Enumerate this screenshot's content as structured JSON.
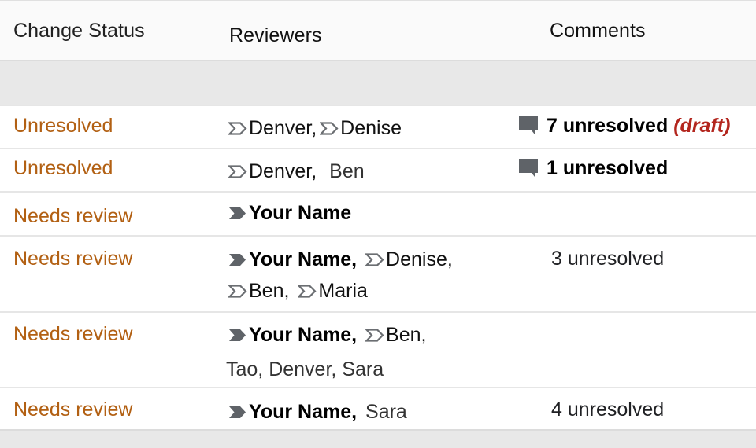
{
  "header": {
    "columns": [
      "Change Status",
      "Reviewers",
      "Comments"
    ]
  },
  "colors": {
    "status": "#b26013",
    "draft": "#b3261e",
    "icon": "#5f6368"
  },
  "rows": [
    {
      "status": "Unresolved",
      "reviewers": [
        {
          "name": "Denver,",
          "icon": "attention-outline-icon",
          "bold": false
        },
        {
          "name": "Denise",
          "icon": "attention-outline-icon",
          "bold": false
        }
      ],
      "comments": {
        "text": "7 unresolved",
        "suffix": "(draft)",
        "icon": "comment-bubble-icon",
        "bold": true
      }
    },
    {
      "status": "Unresolved",
      "reviewers": [
        {
          "name": "Denver,",
          "icon": "attention-outline-icon",
          "bold": false
        },
        {
          "name": "Ben",
          "icon": null,
          "bold": false
        }
      ],
      "comments": {
        "text": "1 unresolved",
        "suffix": "",
        "icon": "comment-bubble-icon",
        "bold": true
      }
    },
    {
      "status": "Needs review",
      "reviewers": [
        {
          "name": "Your Name",
          "icon": "attention-filled-icon",
          "bold": true
        }
      ],
      "comments": null
    },
    {
      "status": "Needs review",
      "reviewers": [
        {
          "name": "Your Name,",
          "icon": "attention-filled-icon",
          "bold": true
        },
        {
          "name": "Denise,",
          "icon": "attention-outline-icon",
          "bold": false
        },
        {
          "name": "Ben,",
          "icon": "attention-outline-icon",
          "bold": false
        },
        {
          "name": "Maria",
          "icon": "attention-outline-icon",
          "bold": false
        }
      ],
      "comments": {
        "text": "3 unresolved",
        "suffix": "",
        "icon": null,
        "bold": false
      }
    },
    {
      "status": "Needs review",
      "reviewers": [
        {
          "name": "Your Name,",
          "icon": "attention-filled-icon",
          "bold": true
        },
        {
          "name": "Ben,",
          "icon": "attention-outline-icon",
          "bold": false
        },
        {
          "name": "Tao, Denver, Sara",
          "icon": null,
          "bold": false
        }
      ],
      "comments": null
    },
    {
      "status": "Needs review",
      "reviewers": [
        {
          "name": "Your Name,",
          "icon": "attention-filled-icon",
          "bold": true
        },
        {
          "name": "Sara",
          "icon": null,
          "bold": false
        }
      ],
      "comments": {
        "text": "4 unresolved",
        "suffix": "",
        "icon": null,
        "bold": false
      }
    }
  ]
}
